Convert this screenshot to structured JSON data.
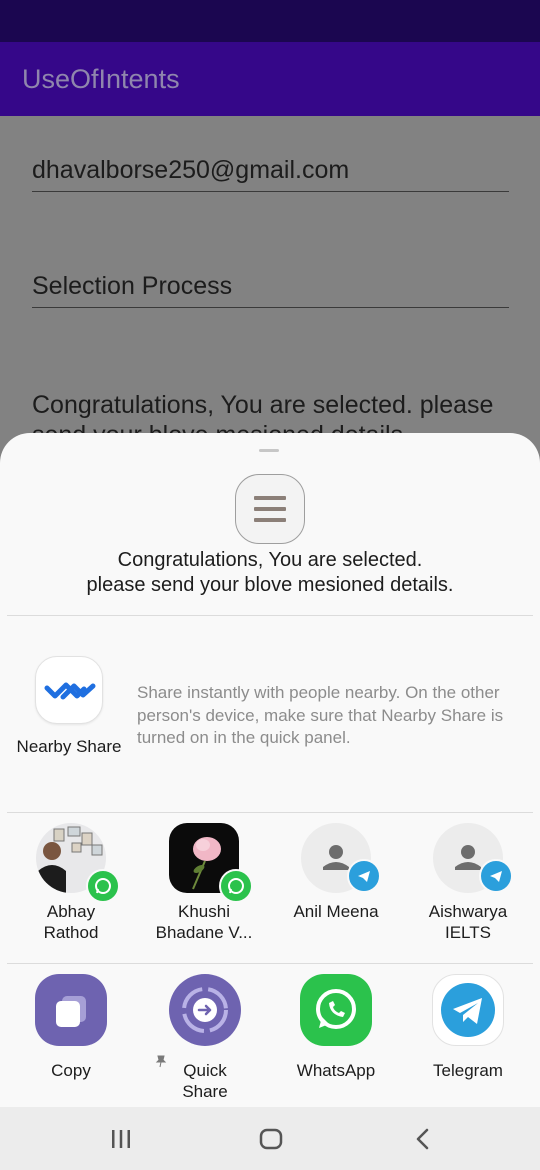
{
  "app": {
    "title": "UseOfIntents"
  },
  "form": {
    "email_value": "dhavalborse250@gmail.com",
    "subject_value": "Selection Process",
    "message_value": "Congratulations, You are selected. please send your blove mesioned details."
  },
  "share_sheet": {
    "preview_text_line1": "Congratulations, You are selected.",
    "preview_text_line2": "please send your blove mesioned details.",
    "nearby_share": {
      "label": "Nearby Share",
      "description": "Share instantly with people nearby. On the other person's device, make sure that Nearby Share is turned on in the quick panel."
    },
    "contacts": [
      {
        "name_line1": "Abhay",
        "name_line2": "Rathod",
        "app_icon": "whatsapp-icon"
      },
      {
        "name_line1": "Khushi",
        "name_line2": "Bhadane V...",
        "app_icon": "whatsapp-icon"
      },
      {
        "name_line1": "Anil Meena",
        "name_line2": "",
        "app_icon": "telegram-icon"
      },
      {
        "name_line1": "Aishwarya",
        "name_line2": "IELTS",
        "app_icon": "telegram-icon"
      }
    ],
    "apps": [
      {
        "label_line1": "Copy",
        "label_line2": "",
        "icon": "copy-icon"
      },
      {
        "label_line1": "Quick",
        "label_line2": "Share",
        "icon": "quick-share-icon",
        "pinned": true
      },
      {
        "label_line1": "WhatsApp",
        "label_line2": "",
        "icon": "whatsapp-icon"
      },
      {
        "label_line1": "Telegram",
        "label_line2": "",
        "icon": "telegram-icon"
      }
    ]
  },
  "nav": {
    "recents_icon": "recents-icon",
    "home_icon": "home-icon",
    "back_icon": "back-icon"
  },
  "colors": {
    "status_bar": "#1b0650",
    "app_bar": "#350789",
    "sheet_background": "#f9f9f9",
    "whatsapp_green": "#2bc24c",
    "telegram_blue": "#2b9fdc",
    "samsung_purple": "#6e63b0"
  }
}
